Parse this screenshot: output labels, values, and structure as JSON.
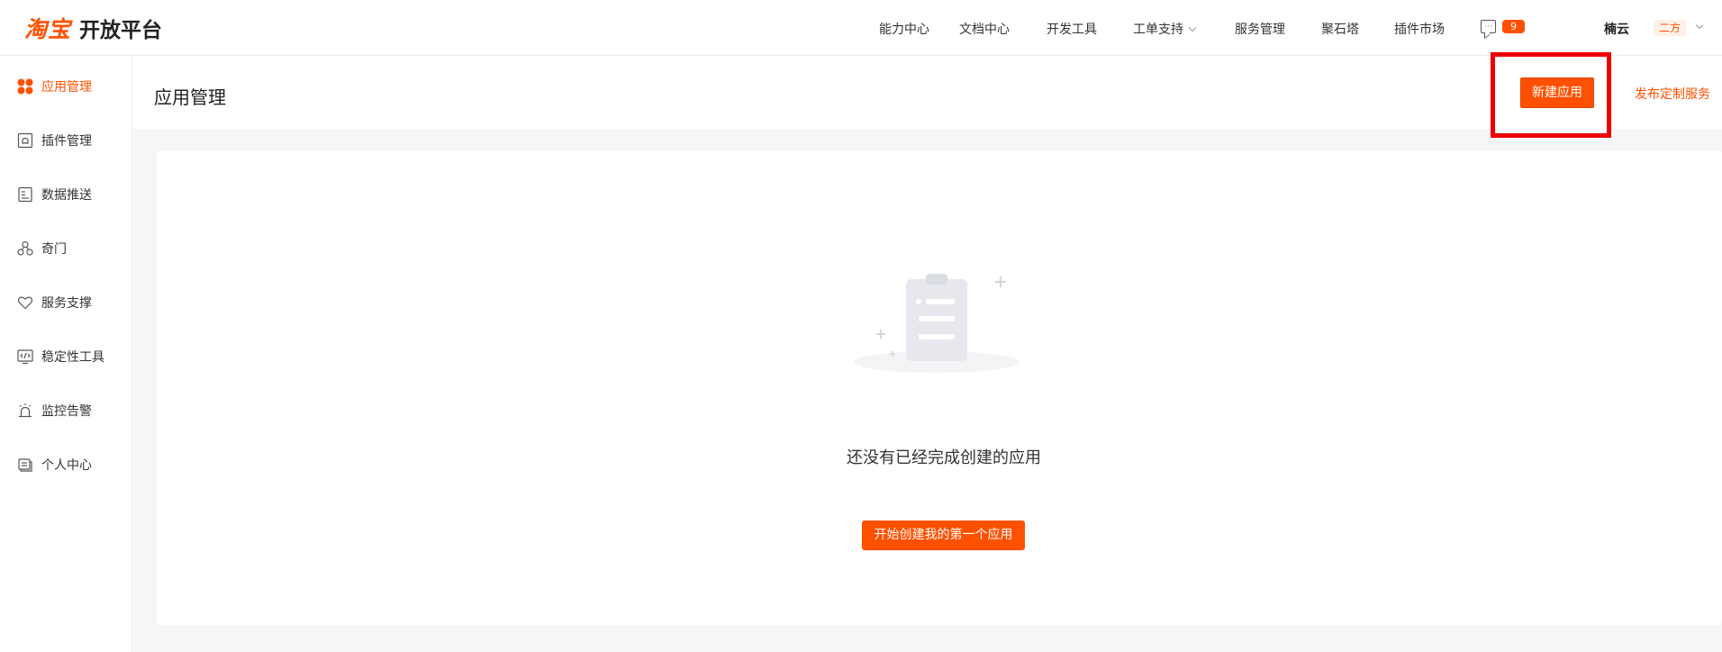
{
  "brand": {
    "logo_text": "淘宝",
    "platform_name": "开放平台",
    "accent_color": "#ff5000"
  },
  "topnav": {
    "items": [
      {
        "label": "能力中心",
        "has_dropdown": false
      },
      {
        "label": "文档中心",
        "has_dropdown": false
      },
      {
        "label": "开发工具",
        "has_dropdown": false
      },
      {
        "label": "工单支持",
        "has_dropdown": true
      },
      {
        "label": "服务管理",
        "has_dropdown": false
      },
      {
        "label": "聚石塔",
        "has_dropdown": false
      },
      {
        "label": "插件市场",
        "has_dropdown": false
      }
    ],
    "message_icon": "message-icon",
    "message_count": "9",
    "user_name": "楠云",
    "role_tag": "二方"
  },
  "sidebar": {
    "items": [
      {
        "label": "应用管理",
        "icon": "app-grid-icon",
        "active": true
      },
      {
        "label": "插件管理",
        "icon": "plugin-icon",
        "active": false
      },
      {
        "label": "数据推送",
        "icon": "data-push-icon",
        "active": false
      },
      {
        "label": "奇门",
        "icon": "qimen-icon",
        "active": false
      },
      {
        "label": "服务支撑",
        "icon": "heart-icon",
        "active": false
      },
      {
        "label": "稳定性工具",
        "icon": "code-monitor-icon",
        "active": false
      },
      {
        "label": "监控告警",
        "icon": "alarm-icon",
        "active": false
      },
      {
        "label": "个人中心",
        "icon": "personal-center-icon",
        "active": false
      }
    ]
  },
  "main": {
    "title": "应用管理",
    "new_app_button": "新建应用",
    "publish_link": "发布定制服务",
    "empty_state": {
      "illustration": "empty-clipboard-icon",
      "message": "还没有已经完成创建的应用",
      "cta_button": "开始创建我的第一个应用"
    }
  }
}
